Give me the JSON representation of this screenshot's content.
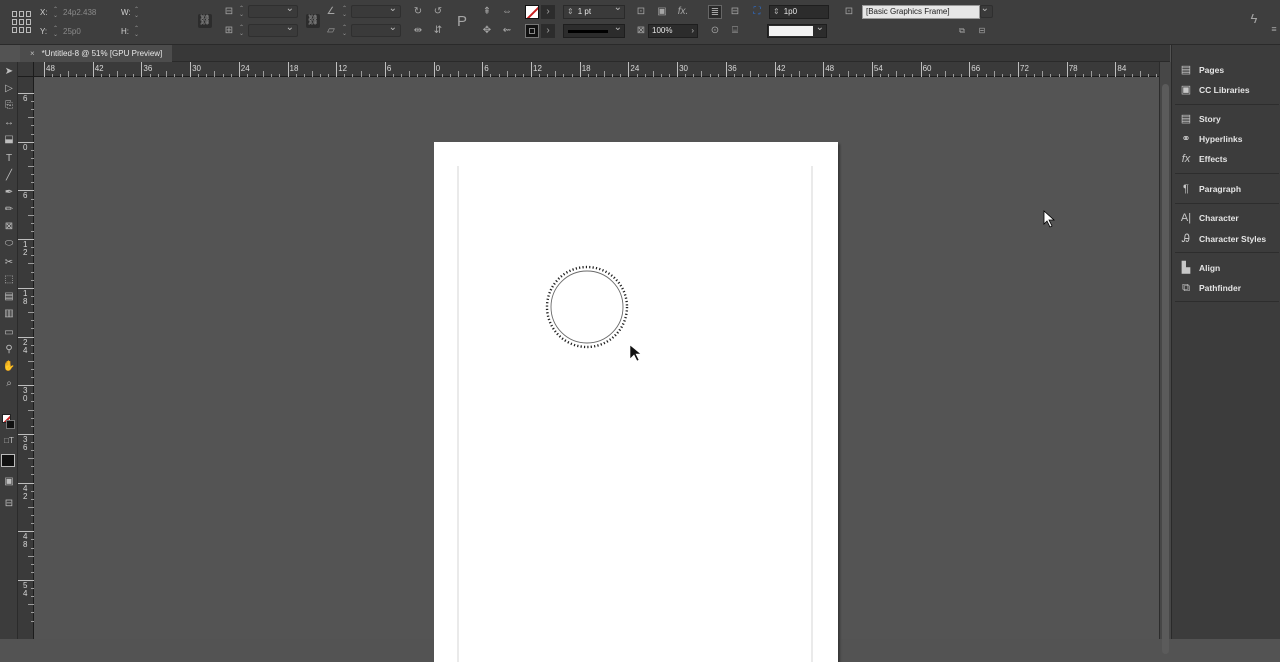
{
  "control": {
    "x_label": "X:",
    "x_value": "24p2.438",
    "y_label": "Y:",
    "y_value": "25p0",
    "w_label": "W:",
    "h_label": "H:",
    "stroke_weight": "1 pt",
    "opacity": "100%",
    "gap_value": "1p0",
    "object_style": "[Basic Graphics Frame]"
  },
  "document_tab": {
    "close": "×",
    "title": "*Untitled-8 @ 51% [GPU Preview]"
  },
  "hruler_labels": [
    "48",
    "42",
    "36",
    "30",
    "24",
    "18",
    "12",
    "6",
    "0",
    "6",
    "12",
    "18",
    "24",
    "30",
    "36",
    "42",
    "48",
    "54",
    "60",
    "66",
    "72",
    "78",
    "84"
  ],
  "vruler_labels": [
    "6",
    "0",
    "6",
    "12",
    "18",
    "24",
    "30",
    "36",
    "42",
    "48",
    "54"
  ],
  "panels": [
    {
      "label": "Pages",
      "icon": "pages-icon"
    },
    {
      "label": "CC Libraries",
      "icon": "cc-libraries-icon"
    },
    {
      "label": "Story",
      "icon": "story-icon"
    },
    {
      "label": "Hyperlinks",
      "icon": "hyperlinks-icon"
    },
    {
      "label": "Effects",
      "icon": "fx-icon"
    },
    {
      "label": "Paragraph",
      "icon": "paragraph-icon"
    },
    {
      "label": "Character",
      "icon": "character-icon"
    },
    {
      "label": "Character Styles",
      "icon": "character-styles-icon"
    },
    {
      "label": "Align",
      "icon": "align-icon"
    },
    {
      "label": "Pathfinder",
      "icon": "pathfinder-icon"
    }
  ],
  "colors": {
    "accent": "#2c6fd1",
    "stroke_none": "#c82020"
  }
}
